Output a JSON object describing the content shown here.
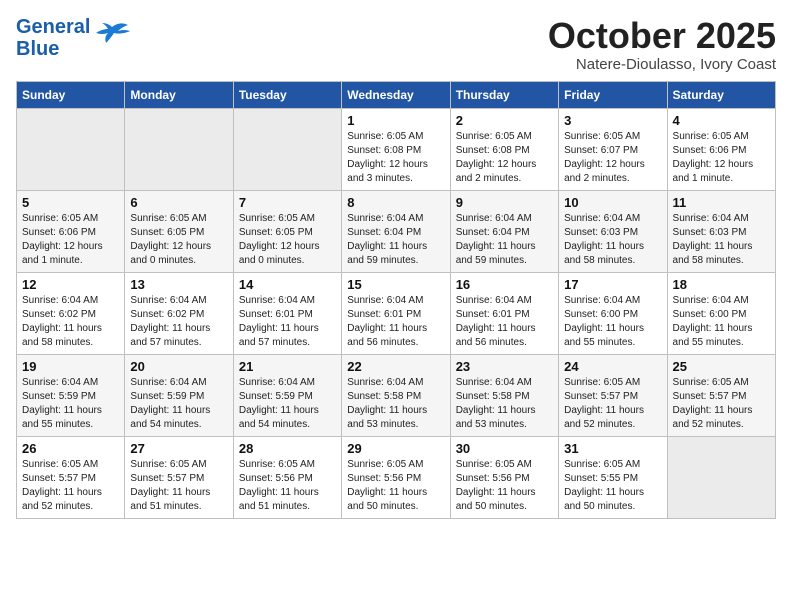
{
  "header": {
    "logo_line1": "General",
    "logo_line2": "Blue",
    "month": "October 2025",
    "location": "Natere-Dioulasso, Ivory Coast"
  },
  "days_of_week": [
    "Sunday",
    "Monday",
    "Tuesday",
    "Wednesday",
    "Thursday",
    "Friday",
    "Saturday"
  ],
  "weeks": [
    [
      {
        "day": "",
        "info": ""
      },
      {
        "day": "",
        "info": ""
      },
      {
        "day": "",
        "info": ""
      },
      {
        "day": "1",
        "info": "Sunrise: 6:05 AM\nSunset: 6:08 PM\nDaylight: 12 hours\nand 3 minutes."
      },
      {
        "day": "2",
        "info": "Sunrise: 6:05 AM\nSunset: 6:08 PM\nDaylight: 12 hours\nand 2 minutes."
      },
      {
        "day": "3",
        "info": "Sunrise: 6:05 AM\nSunset: 6:07 PM\nDaylight: 12 hours\nand 2 minutes."
      },
      {
        "day": "4",
        "info": "Sunrise: 6:05 AM\nSunset: 6:06 PM\nDaylight: 12 hours\nand 1 minute."
      }
    ],
    [
      {
        "day": "5",
        "info": "Sunrise: 6:05 AM\nSunset: 6:06 PM\nDaylight: 12 hours\nand 1 minute."
      },
      {
        "day": "6",
        "info": "Sunrise: 6:05 AM\nSunset: 6:05 PM\nDaylight: 12 hours\nand 0 minutes."
      },
      {
        "day": "7",
        "info": "Sunrise: 6:05 AM\nSunset: 6:05 PM\nDaylight: 12 hours\nand 0 minutes."
      },
      {
        "day": "8",
        "info": "Sunrise: 6:04 AM\nSunset: 6:04 PM\nDaylight: 11 hours\nand 59 minutes."
      },
      {
        "day": "9",
        "info": "Sunrise: 6:04 AM\nSunset: 6:04 PM\nDaylight: 11 hours\nand 59 minutes."
      },
      {
        "day": "10",
        "info": "Sunrise: 6:04 AM\nSunset: 6:03 PM\nDaylight: 11 hours\nand 58 minutes."
      },
      {
        "day": "11",
        "info": "Sunrise: 6:04 AM\nSunset: 6:03 PM\nDaylight: 11 hours\nand 58 minutes."
      }
    ],
    [
      {
        "day": "12",
        "info": "Sunrise: 6:04 AM\nSunset: 6:02 PM\nDaylight: 11 hours\nand 58 minutes."
      },
      {
        "day": "13",
        "info": "Sunrise: 6:04 AM\nSunset: 6:02 PM\nDaylight: 11 hours\nand 57 minutes."
      },
      {
        "day": "14",
        "info": "Sunrise: 6:04 AM\nSunset: 6:01 PM\nDaylight: 11 hours\nand 57 minutes."
      },
      {
        "day": "15",
        "info": "Sunrise: 6:04 AM\nSunset: 6:01 PM\nDaylight: 11 hours\nand 56 minutes."
      },
      {
        "day": "16",
        "info": "Sunrise: 6:04 AM\nSunset: 6:01 PM\nDaylight: 11 hours\nand 56 minutes."
      },
      {
        "day": "17",
        "info": "Sunrise: 6:04 AM\nSunset: 6:00 PM\nDaylight: 11 hours\nand 55 minutes."
      },
      {
        "day": "18",
        "info": "Sunrise: 6:04 AM\nSunset: 6:00 PM\nDaylight: 11 hours\nand 55 minutes."
      }
    ],
    [
      {
        "day": "19",
        "info": "Sunrise: 6:04 AM\nSunset: 5:59 PM\nDaylight: 11 hours\nand 55 minutes."
      },
      {
        "day": "20",
        "info": "Sunrise: 6:04 AM\nSunset: 5:59 PM\nDaylight: 11 hours\nand 54 minutes."
      },
      {
        "day": "21",
        "info": "Sunrise: 6:04 AM\nSunset: 5:59 PM\nDaylight: 11 hours\nand 54 minutes."
      },
      {
        "day": "22",
        "info": "Sunrise: 6:04 AM\nSunset: 5:58 PM\nDaylight: 11 hours\nand 53 minutes."
      },
      {
        "day": "23",
        "info": "Sunrise: 6:04 AM\nSunset: 5:58 PM\nDaylight: 11 hours\nand 53 minutes."
      },
      {
        "day": "24",
        "info": "Sunrise: 6:05 AM\nSunset: 5:57 PM\nDaylight: 11 hours\nand 52 minutes."
      },
      {
        "day": "25",
        "info": "Sunrise: 6:05 AM\nSunset: 5:57 PM\nDaylight: 11 hours\nand 52 minutes."
      }
    ],
    [
      {
        "day": "26",
        "info": "Sunrise: 6:05 AM\nSunset: 5:57 PM\nDaylight: 11 hours\nand 52 minutes."
      },
      {
        "day": "27",
        "info": "Sunrise: 6:05 AM\nSunset: 5:57 PM\nDaylight: 11 hours\nand 51 minutes."
      },
      {
        "day": "28",
        "info": "Sunrise: 6:05 AM\nSunset: 5:56 PM\nDaylight: 11 hours\nand 51 minutes."
      },
      {
        "day": "29",
        "info": "Sunrise: 6:05 AM\nSunset: 5:56 PM\nDaylight: 11 hours\nand 50 minutes."
      },
      {
        "day": "30",
        "info": "Sunrise: 6:05 AM\nSunset: 5:56 PM\nDaylight: 11 hours\nand 50 minutes."
      },
      {
        "day": "31",
        "info": "Sunrise: 6:05 AM\nSunset: 5:55 PM\nDaylight: 11 hours\nand 50 minutes."
      },
      {
        "day": "",
        "info": ""
      }
    ]
  ]
}
